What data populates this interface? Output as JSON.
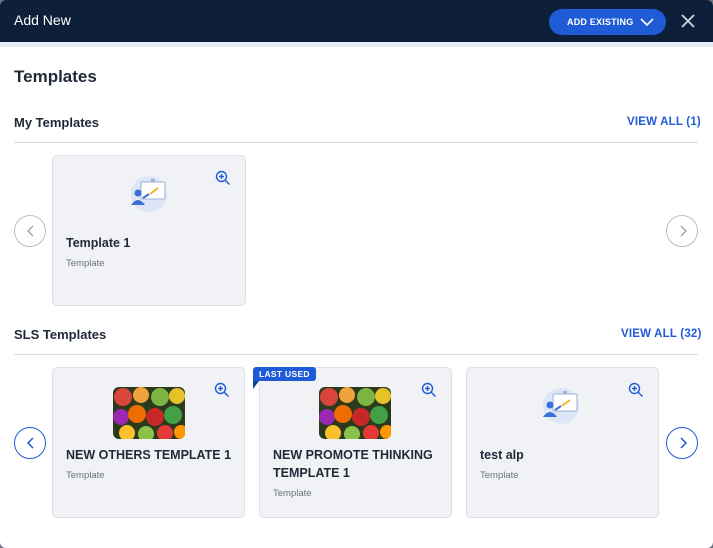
{
  "modal": {
    "title": "Add New",
    "add_existing_label": "ADD EXISTING"
  },
  "page_title": "Templates",
  "my_templates": {
    "title": "My Templates",
    "view_all_label": "VIEW ALL (1)",
    "items": [
      {
        "name": "Template 1",
        "type": "Template",
        "thumbnail": "presentation-icon"
      }
    ]
  },
  "sls_templates": {
    "title": "SLS Templates",
    "view_all_label": "VIEW ALL (32)",
    "items": [
      {
        "name": "NEW OTHERS TEMPLATE 1",
        "type": "Template",
        "thumbnail": "fruit-image"
      },
      {
        "name": "NEW PROMOTE THINKING TEMPLATE 1",
        "type": "Template",
        "thumbnail": "fruit-image",
        "badge": "LAST USED"
      },
      {
        "name": "test alp",
        "type": "Template",
        "thumbnail": "presentation-icon"
      }
    ]
  },
  "colors": {
    "header_bg": "#0e1f3a",
    "accent": "#1f5bd6",
    "card_bg": "#f1f2f6"
  }
}
